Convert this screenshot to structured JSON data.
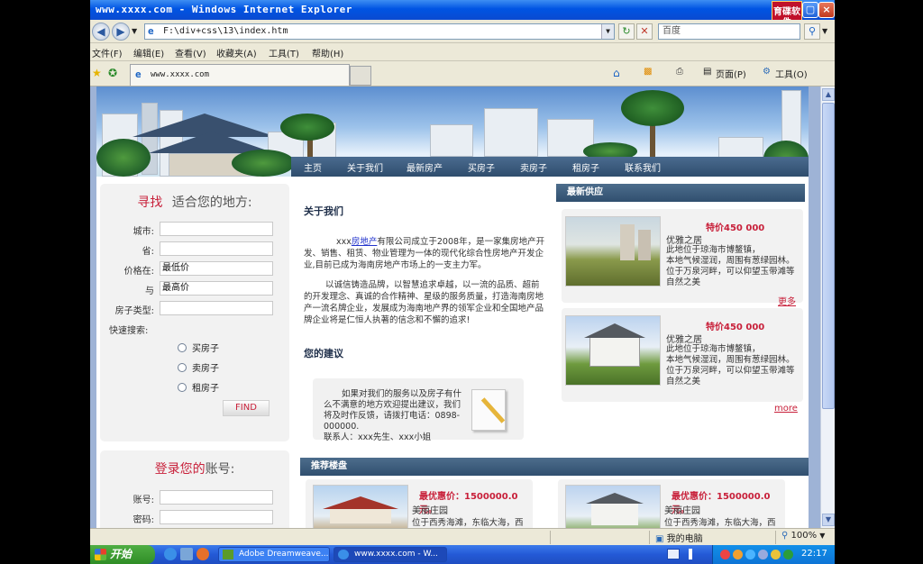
{
  "window": {
    "title": "www.xxxx.com - Windows Internet Explorer",
    "brand_logo": "育碟软件",
    "controls": [
      "_",
      "▢",
      "×"
    ]
  },
  "addressbar": {
    "url": "F:\\div+css\\13\\index.htm",
    "search_placeholder": "百度"
  },
  "menu": [
    "文件(F)",
    "编辑(E)",
    "查看(V)",
    "收藏夹(A)",
    "工具(T)",
    "帮助(H)"
  ],
  "tab": {
    "label": "www.xxxx.com"
  },
  "toolbar": {
    "page_label": "页面(P)",
    "tools_label": "工具(O)"
  },
  "site": {
    "nav": [
      "主页",
      "关于我们",
      "最新房产",
      "买房子",
      "卖房子",
      "租房子",
      "联系我们"
    ],
    "search_panel": {
      "title_red": "寻找",
      "title_rest": "适合您的地方:",
      "fields": [
        {
          "label": "城市:",
          "value": ""
        },
        {
          "label": "省:",
          "value": ""
        },
        {
          "label": "价格在:",
          "value": "最低价"
        },
        {
          "label": "与",
          "value": "最高价"
        },
        {
          "label": "房子类型:",
          "value": ""
        }
      ],
      "quick_label": "快速搜索:",
      "radios": [
        "买房子",
        "卖房子",
        "租房子"
      ],
      "find_button": "FIND"
    },
    "login_panel": {
      "title_red": "登录您的",
      "title_rest": "账号:",
      "fields": [
        {
          "label": "账号:",
          "value": ""
        },
        {
          "label": "密码:",
          "value": ""
        }
      ]
    },
    "about": {
      "heading": "关于我们",
      "para1_prefix": "xxx",
      "para1_link": "房地产",
      "para1_rest": "有限公司成立于2008年，是一家集房地产开发、销售、租赁、物业管理为一体的现代化综合性房地产开发企业,目前已成为海南房地产市场上的一支主力军。",
      "para2": "以诚信铸造品牌，以智慧追求卓越，以一流的品质、超前的开发理念、真诚的合作精神、星级的服务质量，打造海南房地产一流名牌企业，发展成为海南地产界的领军企业和全国地产品牌企业将是仁恒人执著的信念和不懈的追求!"
    },
    "suggest": {
      "heading": "您的建议",
      "text": "如果对我们的服务以及房子有什么不满意的地方欢迎提出建议，我们将及时作反馈，请拨打电话：0898-000000.",
      "contact": "联系人：xxx先生、xxx小姐"
    },
    "latest": {
      "heading": "最新供应",
      "items": [
        {
          "price": "特价450 000",
          "name": "优雅之居",
          "desc1": "此地位于琼海市博鳌镇，",
          "desc2": "本地气候湿润，周围有葱绿园林。位于万泉河畔，可以仰望玉带滩等自然之美",
          "more": "更多"
        },
        {
          "price": "特价450 000",
          "name": "优雅之居",
          "desc1": "此地位于琼海市博鳌镇，",
          "desc2": "本地气候湿润，周围有葱绿园林。位于万泉河畔，可以仰望玉带滩等自然之美",
          "more": "more"
        }
      ]
    },
    "recommend": {
      "heading": "推荐楼盘",
      "items": [
        {
          "price": "最优惠价：1500000.0元。",
          "name": "美丽庄园",
          "desc": "位于西秀海滩，东临大海，西"
        },
        {
          "price": "最优惠价：1500000.0元。",
          "name": "美丽庄园",
          "desc": "位于西秀海滩，东临大海，西"
        }
      ]
    }
  },
  "statusbar": {
    "zone": "我的电脑",
    "zoom": "100%"
  },
  "taskbar": {
    "start": "开始",
    "tasks": [
      "Adobe Dreamweave...",
      "www.xxxx.com - W..."
    ],
    "clock": "22:17"
  },
  "colors": {
    "accent_red": "#c8203a",
    "nav_bg": "#3b5a7c",
    "xp_blue": "#0054e3"
  }
}
